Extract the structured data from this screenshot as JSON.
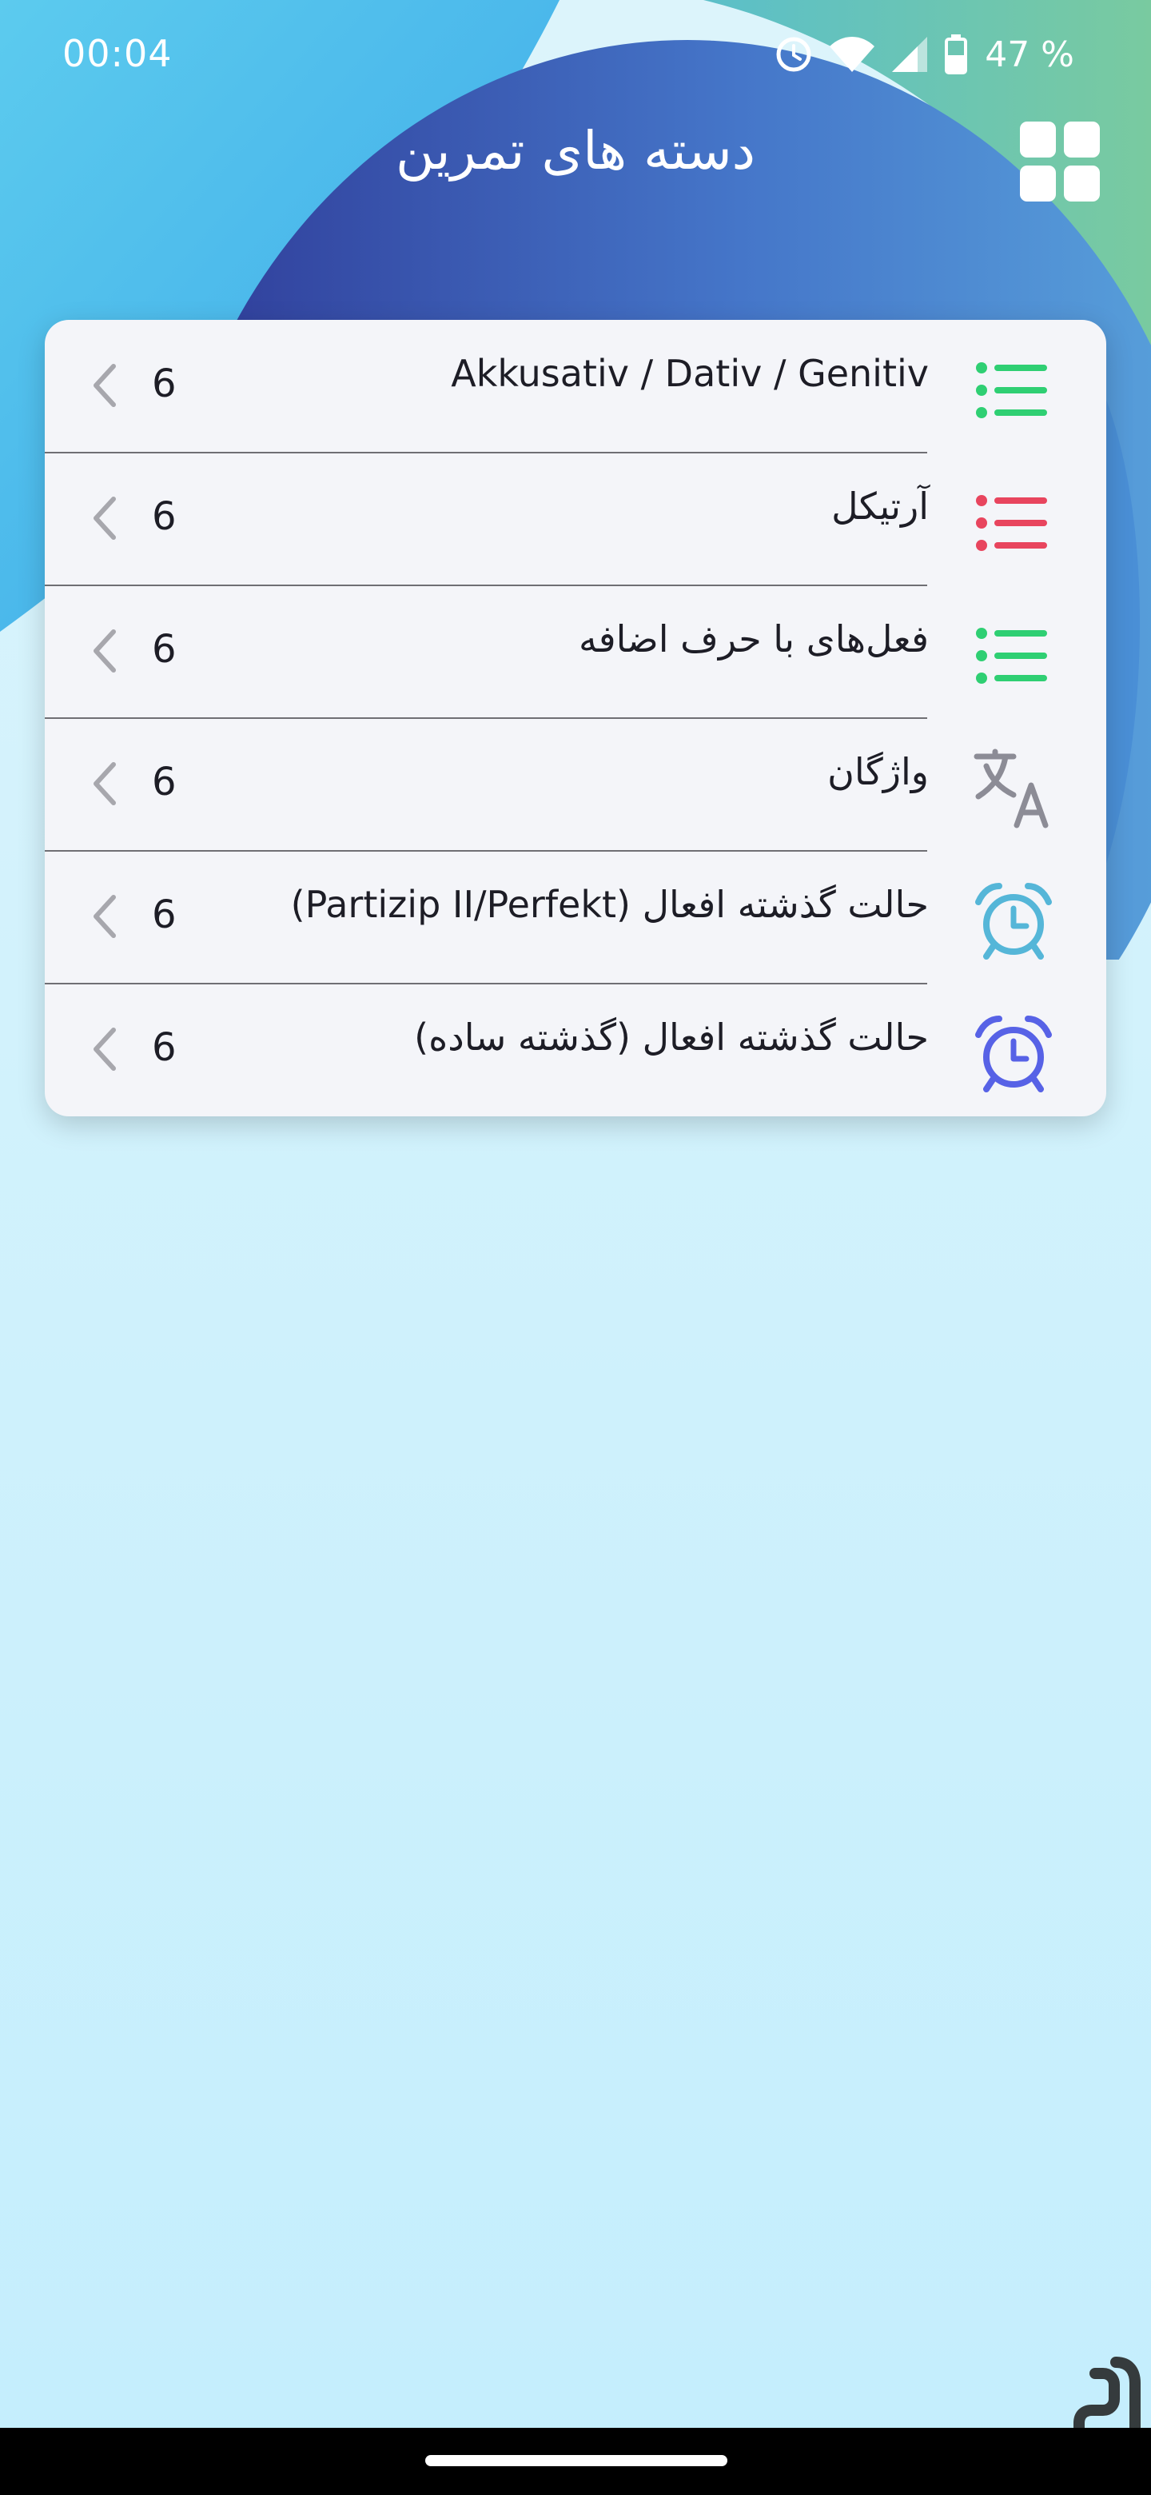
{
  "status_bar": {
    "time": "00:04",
    "battery_text": "47 %",
    "icons": [
      "alarm-icon",
      "wifi-icon",
      "signal-icon",
      "battery-icon"
    ]
  },
  "header": {
    "title": "دسته های تمرین",
    "grid_icon": "grid-icon"
  },
  "colors": {
    "green": "#2fcf73",
    "red": "#e8455e",
    "gray": "#8c8c96",
    "teal": "#55b6d8",
    "blue": "#5762e6"
  },
  "categories": [
    {
      "label": "Akkusativ / Dativ / Genitiv",
      "count": "6",
      "icon": "list-icon"
    },
    {
      "label": "آرتیکل",
      "count": "6",
      "icon": "list-icon"
    },
    {
      "label": "فعل‌های با حرف اضافه",
      "count": "6",
      "icon": "list-icon"
    },
    {
      "label": "واژگان",
      "count": "6",
      "icon": "translate-icon"
    },
    {
      "label": "حالت گذشته افعال (Partizip II/Perfekt)",
      "count": "6",
      "icon": "alarm-clock-icon"
    },
    {
      "label": "حالت گذشته افعال (گذشته ساده)",
      "count": "6",
      "icon": "alarm-clock-icon"
    }
  ]
}
